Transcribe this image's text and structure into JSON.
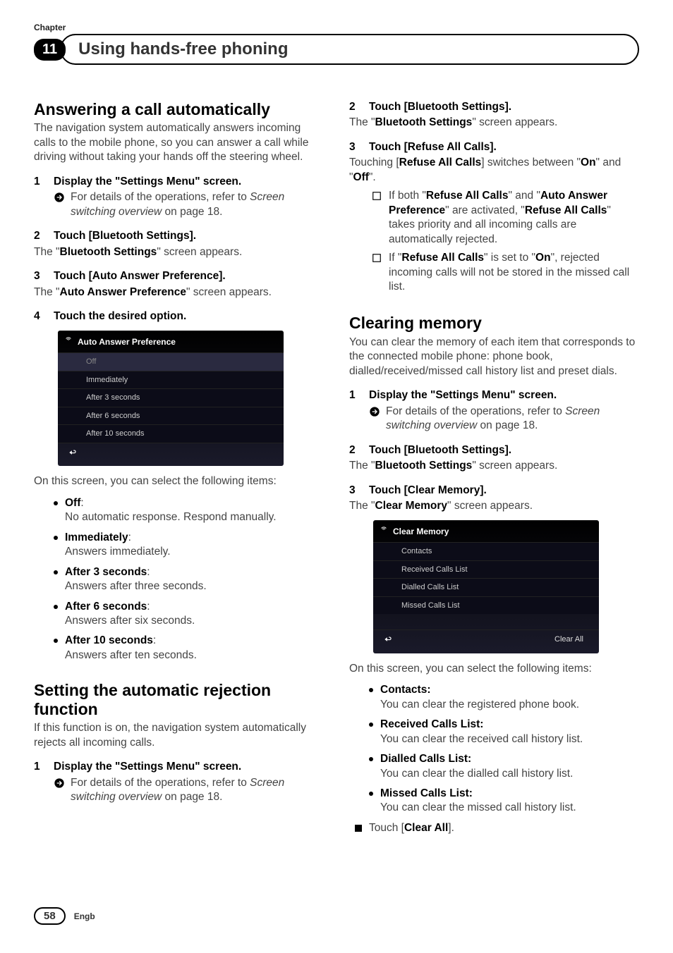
{
  "chapter": {
    "label": "Chapter",
    "number": "11",
    "title": "Using hands-free phoning"
  },
  "left": {
    "h1": "Answering a call automatically",
    "intro": "The navigation system automatically answers incoming calls to the mobile phone, so you can answer a call while driving without taking your hands off the steering wheel.",
    "step1": "Display the \"Settings Menu\" screen.",
    "step1sub_a": "For details of the operations, refer to ",
    "step1sub_i": "Screen switching overview",
    "step1sub_b": " on page 18.",
    "step2": "Touch [Bluetooth Settings].",
    "step2after_a": "The \"",
    "step2after_bold": "Bluetooth Settings",
    "step2after_b": "\" screen appears.",
    "step3": "Touch [Auto Answer Preference].",
    "step3after_a": "The \"",
    "step3after_bold": "Auto Answer Preference",
    "step3after_b": "\" screen appears.",
    "step4": "Touch the desired option.",
    "ss_title": "Auto Answer Preference",
    "ss_rows": {
      "r0": "Off",
      "r1": "Immediately",
      "r2": "After 3 seconds",
      "r3": "After 6 seconds",
      "r4": "After 10 seconds"
    },
    "aftershot": "On this screen, you can select the following items:",
    "opts": {
      "off_t": "Off",
      "off_d": "No automatic response. Respond manually.",
      "imm_t": "Immediately",
      "imm_d": "Answers immediately.",
      "a3_t": "After 3 seconds",
      "a3_d": "Answers after three seconds.",
      "a6_t": "After 6 seconds",
      "a6_d": "Answers after six seconds.",
      "a10_t": "After 10 seconds",
      "a10_d": "Answers after ten seconds."
    },
    "h2": "Setting the automatic rejection function",
    "h2intro": "If this function is on, the navigation system automatically rejects all incoming calls.",
    "h2step1": "Display the \"Settings Menu\" screen.",
    "h2step1sub_a": "For details of the operations, refer to ",
    "h2step1sub_i": "Screen switching overview",
    "h2step1sub_b": " on page 18."
  },
  "right": {
    "step2": "Touch [Bluetooth Settings].",
    "step2after_a": "The \"",
    "step2after_bold": "Bluetooth Settings",
    "step2after_b": "\" screen appears.",
    "step3": "Touch [Refuse All Calls].",
    "step3line_a": "Touching [",
    "step3line_bold": "Refuse All Calls",
    "step3line_b": "] switches between \"",
    "step3line_on": "On",
    "step3line_c": "\" and \"",
    "step3line_off": "Off",
    "step3line_d": "\".",
    "note1_a": "If both \"",
    "note1_b": "Refuse All Calls",
    "note1_c": "\" and \"",
    "note1_d": "Auto Answer Preference",
    "note1_e": "\" are activated, \"",
    "note1_f": "Refuse All Calls",
    "note1_g": "\" takes priority and all incoming calls are automatically rejected.",
    "note2_a": "If \"",
    "note2_b": "Refuse All Calls",
    "note2_c": "\" is set to \"",
    "note2_d": "On",
    "note2_e": "\", rejected incoming calls will not be stored in the missed call list.",
    "h3": "Clearing memory",
    "h3intro": "You can clear the memory of each item that corresponds to the connected mobile phone: phone book, dialled/received/missed call history list and preset dials.",
    "cstep1": "Display the \"Settings Menu\" screen.",
    "cstep1sub_a": "For details of the operations, refer to ",
    "cstep1sub_i": "Screen switching overview",
    "cstep1sub_b": " on page 18.",
    "cstep2": "Touch [Bluetooth Settings].",
    "cstep2after_a": "The \"",
    "cstep2after_bold": "Bluetooth Settings",
    "cstep2after_b": "\" screen appears.",
    "cstep3": "Touch [Clear Memory].",
    "cstep3after_a": "The \"",
    "cstep3after_bold": "Clear Memory",
    "cstep3after_b": "\" screen appears.",
    "ss2_title": "Clear Memory",
    "ss2_rows": {
      "r0": "Contacts",
      "r1": "Received Calls List",
      "r2": "Dialled Calls List",
      "r3": "Missed Calls List"
    },
    "ss2_clearall": "Clear All",
    "aftershot2": "On this screen, you can select the following items:",
    "copts": {
      "c_t": "Contacts:",
      "c_d": "You can clear the registered phone book.",
      "r_t": "Received Calls List:",
      "r_d": "You can clear the received call history list.",
      "d_t": "Dialled Calls List:",
      "d_d": "You can clear the dialled call history list.",
      "m_t": "Missed Calls List:",
      "m_d": "You can clear the missed call history list."
    },
    "tail_a": "Touch [",
    "tail_b": "Clear All",
    "tail_c": "]."
  },
  "footer": {
    "page": "58",
    "lang": "Engb"
  }
}
